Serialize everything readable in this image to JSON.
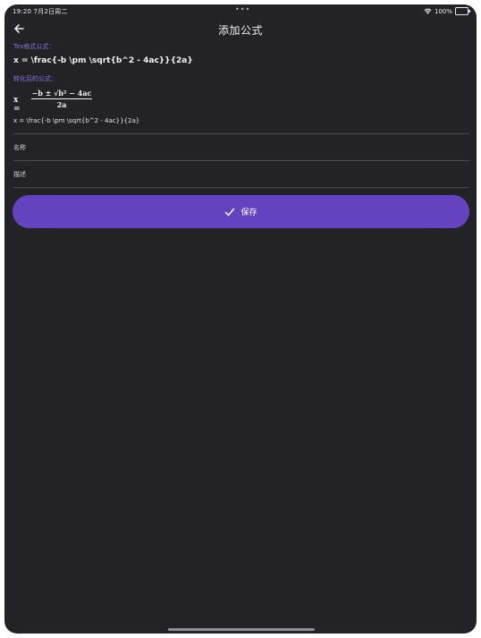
{
  "status_bar": {
    "time_date": "19:20  7月2日周二",
    "center_dots": "•••",
    "battery_text": "100%"
  },
  "header": {
    "title": "添加公式"
  },
  "tex_section": {
    "label": "Tex格式公式：",
    "value": "x = \\frac{-b \\pm \\sqrt{b^2 - 4ac}}{2a}"
  },
  "converted_section": {
    "label": "转化后的公式：",
    "lhs": "x =",
    "numerator": "−b ± √b² − 4ac",
    "denominator": "2a"
  },
  "form": {
    "formula_value": "x = \\frac{-b \\pm \\sqrt{b^2 - 4ac}}{2a}",
    "name_placeholder": "名称",
    "description_placeholder": "描述"
  },
  "save_button": {
    "label": "保存"
  },
  "colors": {
    "background": "#232226",
    "accent": "#6443c0",
    "label_accent": "#8c74d9"
  }
}
